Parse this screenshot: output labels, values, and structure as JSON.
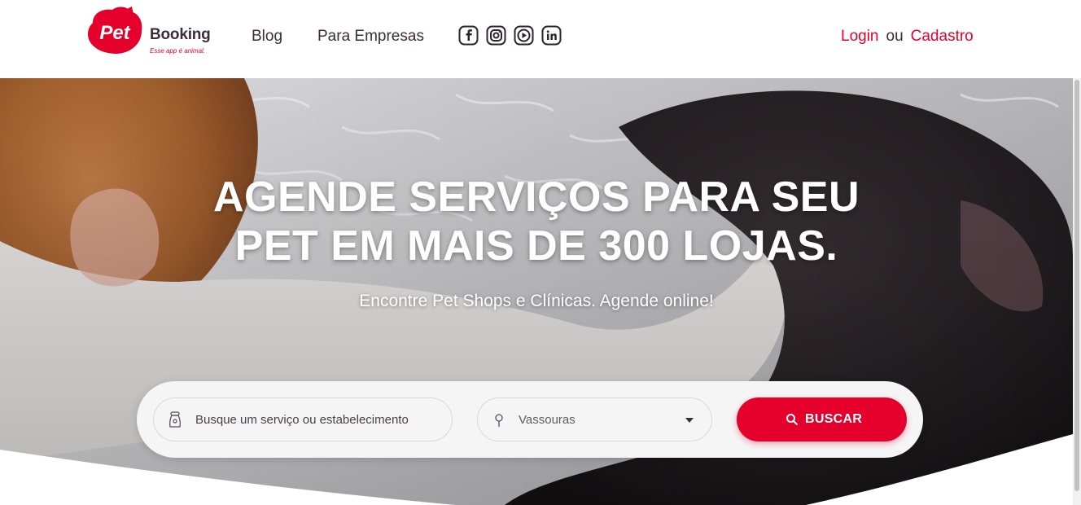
{
  "brand": {
    "badge_text": "Pet",
    "name": "Booking",
    "tagline": "Esse app é animal.",
    "color": "#e4002b"
  },
  "nav": {
    "blog": "Blog",
    "empresas": "Para Empresas"
  },
  "social": [
    "facebook-icon",
    "instagram-icon",
    "youtube-icon",
    "linkedin-icon"
  ],
  "auth": {
    "login": "Login",
    "separator": "ou",
    "signup": "Cadastro"
  },
  "hero": {
    "headline_line1": "AGENDE SERVIÇOS PARA SEU",
    "headline_line2": "PET EM MAIS DE 300 LOJAS.",
    "subheadline": "Encontre Pet Shops e Clínicas. Agende online!"
  },
  "search": {
    "service_placeholder": "Busque um serviço ou estabelecimento",
    "city_value": "Vassouras",
    "button_label": "BUSCAR"
  }
}
